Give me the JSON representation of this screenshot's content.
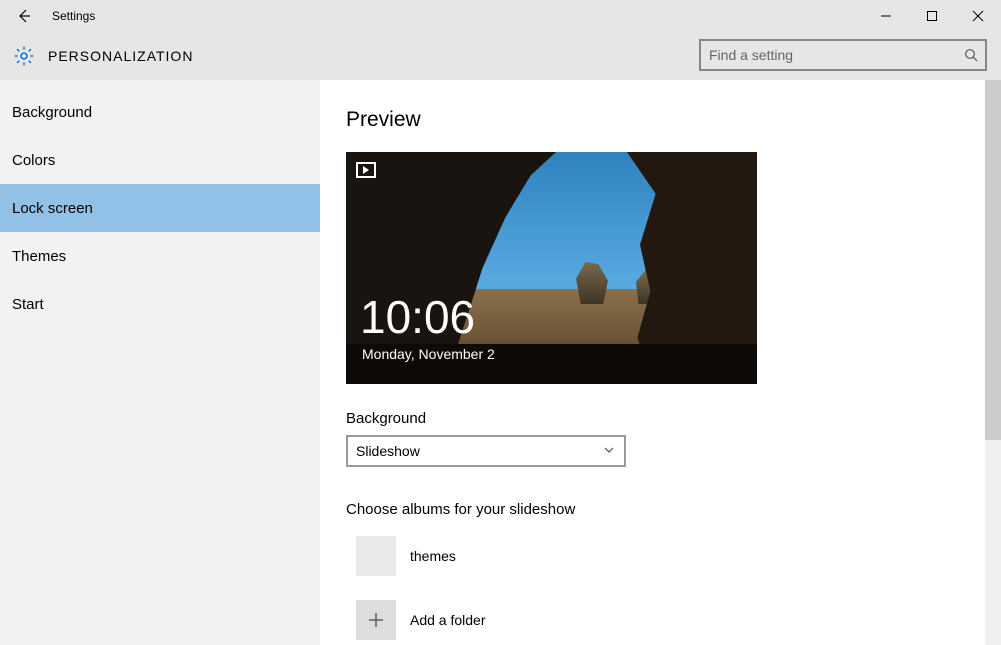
{
  "window": {
    "title": "Settings"
  },
  "header": {
    "title": "PERSONALIZATION"
  },
  "search": {
    "placeholder": "Find a setting"
  },
  "sidebar": {
    "items": [
      {
        "label": "Background",
        "selected": false
      },
      {
        "label": "Colors",
        "selected": false
      },
      {
        "label": "Lock screen",
        "selected": true
      },
      {
        "label": "Themes",
        "selected": false
      },
      {
        "label": "Start",
        "selected": false
      }
    ]
  },
  "content": {
    "heading": "Preview",
    "preview": {
      "time": "10:06",
      "date": "Monday, November 2",
      "badge_icon": "slideshow-icon"
    },
    "background_section": {
      "label": "Background",
      "selected_value": "Slideshow"
    },
    "albums_section": {
      "label": "Choose albums for your slideshow",
      "items": [
        {
          "name": "themes"
        }
      ],
      "add_label": "Add a folder"
    }
  },
  "colors": {
    "selection": "#91c1e7",
    "sidebar_bg": "#f2f2f2",
    "chrome_bg": "#e6e6e6"
  }
}
